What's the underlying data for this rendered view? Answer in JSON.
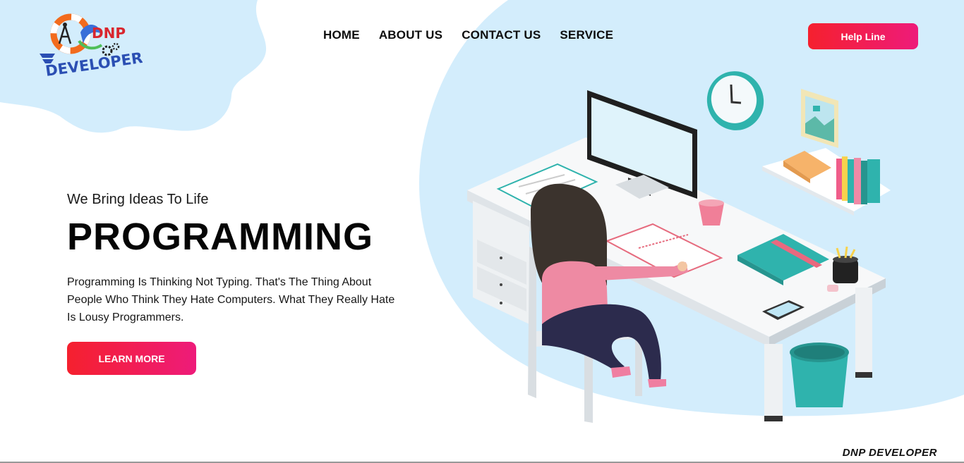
{
  "brand": {
    "logo_top": "DNP",
    "logo_bottom": "DEVELOPER",
    "footer": "DNP DEVELOPER"
  },
  "nav": {
    "items": [
      {
        "label": "HOME"
      },
      {
        "label": "ABOUT US"
      },
      {
        "label": "CONTACT US"
      },
      {
        "label": "SERVICE"
      }
    ]
  },
  "header": {
    "helpline_label": "Help Line"
  },
  "hero": {
    "tagline": "We Bring Ideas To Life",
    "headline": "PROGRAMMING",
    "description": "Programming Is Thinking Not Typing. That's The Thing About People Who Think They Hate Computers. What They Really Hate Is Lousy Programmers.",
    "cta_label": "LEARN MORE"
  },
  "colors": {
    "accent_start": "#f5202e",
    "accent_end": "#ee1b7a",
    "blob": "#d3edfc",
    "teal": "#2fb3ad"
  }
}
